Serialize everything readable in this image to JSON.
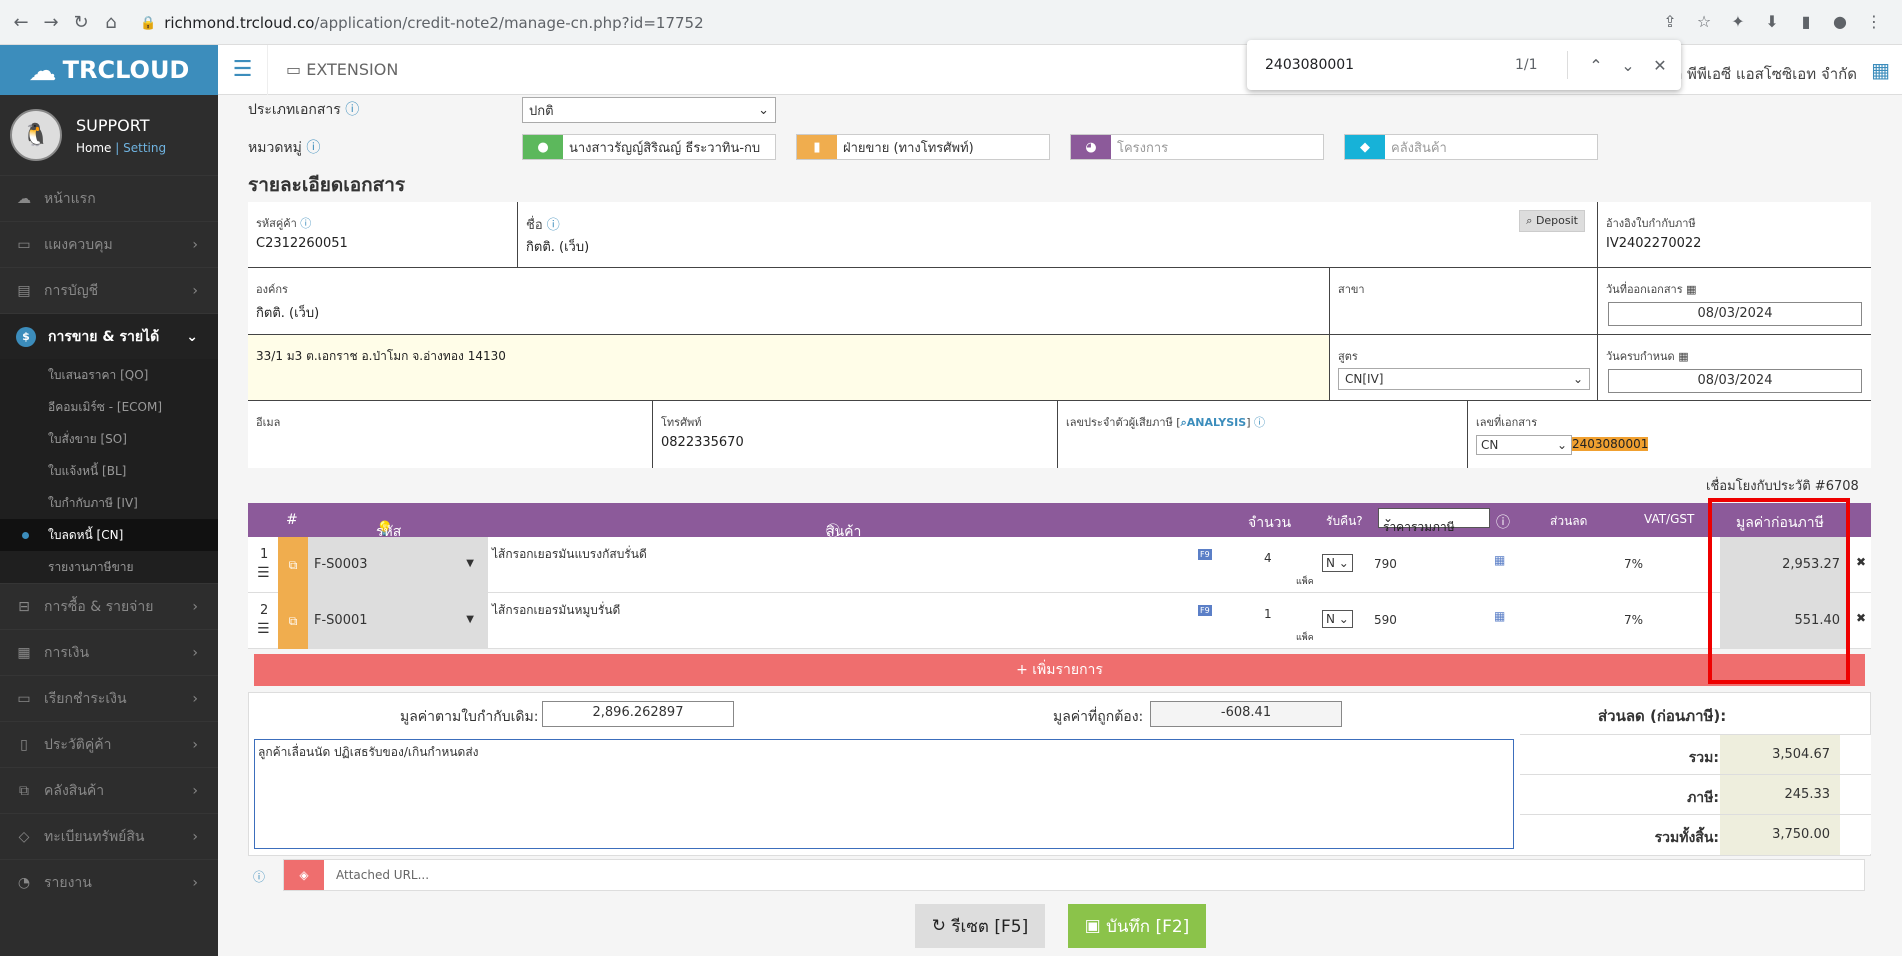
{
  "browser": {
    "url_domain": "richmond.trcloud.co",
    "url_path": "/application/credit-note2/manage-cn.php?id=17752"
  },
  "find": {
    "query": "2403080001",
    "count": "1/1"
  },
  "app": {
    "brand": "TRCLOUD",
    "extension": "EXTENSION",
    "company": "ก พีพีเอซี แอสโซซิเอท จำกัด"
  },
  "user": {
    "name": "SUPPORT",
    "home": "Home",
    "sep": "|",
    "setting": "Setting"
  },
  "menu": [
    {
      "label": "หน้าแรก"
    },
    {
      "label": "แผงควบคุม"
    },
    {
      "label": "การบัญชี"
    },
    {
      "label": "การขาย & รายได้"
    },
    {
      "label": "การซื้อ & รายจ่าย"
    },
    {
      "label": "การเงิน"
    },
    {
      "label": "เรียกชำระเงิน"
    },
    {
      "label": "ประวัติคู่ค้า"
    },
    {
      "label": "คลังสินค้า"
    },
    {
      "label": "ทะเบียนทรัพย์สิน"
    },
    {
      "label": "รายงาน"
    }
  ],
  "submenu": [
    "ใบเสนอราคา [QO]",
    "อีคอมเมิร์ซ - [ECOM]",
    "ใบสั่งขาย [SO]",
    "ใบแจ้งหนี้ [BL]",
    "ใบกำกับภาษี [IV]",
    "ใบลดหนี้ [CN]",
    "รายงานภาษีขาย"
  ],
  "doc": {
    "type_label": "ประเภทเอกสาร",
    "type_value": "ปกติ",
    "cat_label": "หมวดหมู่",
    "cat_person": "นางสาวรัญญ์สิริณญ์ ธีระวาทิน-กบ",
    "cat_dept": "ฝ่ายขาย (ทางโทรศัพท์)",
    "cat_project": "โครงการ",
    "cat_wh": "คลังสินค้า",
    "section": "รายละเอียดเอกสาร",
    "cust_code_label": "รหัสคู่ค้า",
    "cust_code": "C2312260051",
    "name_label": "ชื่อ",
    "name": "กิตติ. (เว็บ)",
    "deposit": "Deposit",
    "ref_label": "อ้างอิงใบกำกับภาษี",
    "ref": "IV2402270022",
    "org_label": "องค์กร",
    "org": "กิตติ. (เว็บ)",
    "branch_label": "สาขา",
    "date_label": "วันที่ออกเอกสาร",
    "date": "08/03/2024",
    "address": "33/1 ม3 ต.เอกราช อ.ป่าโมก จ.อ่างทอง 14130",
    "formula_label": "สูตร",
    "formula": "CN[IV]",
    "due_label": "วันครบกำหนด",
    "due": "08/03/2024",
    "email_label": "อีเมล",
    "phone_label": "โทรศัพท์",
    "phone": "0822335670",
    "taxid_label": "เลขประจำตัวผู้เสียภาษี [",
    "taxid_link": "ANALYSIS",
    "taxid_end": "]",
    "docno_label": "เลขที่เอกสาร",
    "docno_prefix": "CN",
    "docno": "2403080001",
    "linked": "เชื่อมโยงกับประวัติ #6708"
  },
  "table": {
    "headers": {
      "num": "#",
      "code": "รหัส",
      "product": "สินค้า",
      "qty": "จำนวน",
      "return": "รับคืน?",
      "price_type": "ราคารวมภาษี",
      "discount": "ส่วนลด",
      "vat": "VAT/GST",
      "pretax": "มูลค่าก่อนภาษี"
    },
    "rows": [
      {
        "n": "1",
        "code": "F-S0003",
        "desc": "ไส้กรอกเยอรมันแบรงกัสบรั่นดี",
        "qty": "4",
        "unit": "แพ็ค",
        "ret": "N",
        "price": "790",
        "vat": "7%",
        "amount": "2,953.27"
      },
      {
        "n": "2",
        "code": "F-S0001",
        "desc": "ไส้กรอกเยอรมันหมูบรั่นดี",
        "qty": "1",
        "unit": "แพ็ค",
        "ret": "N",
        "price": "590",
        "vat": "7%",
        "amount": "551.40"
      }
    ],
    "add": "+ เพิ่มรายการ"
  },
  "footer": {
    "orig_label": "มูลค่าตามใบกำกับเดิม:",
    "orig": "2,896.262897",
    "correct_label": "มูลค่าที่ถูกต้อง:",
    "correct": "-608.41",
    "note": "ลูกค้าเลื่อนนัด ปฏิเสธรับของ/เกินกำหนดส่ง",
    "disc_label": "ส่วนลด (ก่อนภาษี):",
    "sum_label": "รวม:",
    "sum": "3,504.67",
    "tax_label": "ภาษี:",
    "tax": "245.33",
    "total_label": "รวมทั้งสิ้น:",
    "total": "3,750.00",
    "attach": "Attached URL...",
    "reset": "รีเซต [F5]",
    "save": "บันทึก [F2]"
  }
}
